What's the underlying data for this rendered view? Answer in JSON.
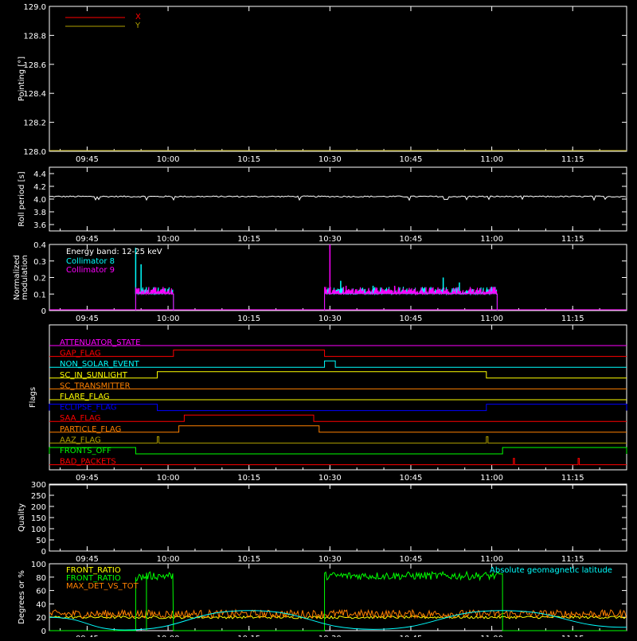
{
  "colors": {
    "background": "#000000",
    "axis": "#ffffff",
    "red": "#ff0000",
    "olive": "#b0a000",
    "cyan": "#00ffff",
    "magenta": "#ff00ff",
    "green": "#00ff00",
    "orange": "#ff8000",
    "yellow": "#ffff00",
    "blue": "#0000ff",
    "quality": "#ffffff"
  },
  "time_ticks": [
    "09:45",
    "10:00",
    "10:15",
    "10:30",
    "10:45",
    "11:00",
    "11:15"
  ],
  "chart_data": [
    {
      "type": "line",
      "id": "pointing",
      "ylabel": "Pointing [°]",
      "ylim": [
        128.0,
        129.0
      ],
      "yticks": [
        "128.0",
        "128.2",
        "128.4",
        "128.6",
        "128.8",
        "129.0"
      ],
      "xlim": [
        "09:38",
        "11:25"
      ],
      "legend": "top-left",
      "series": [
        {
          "name": "X",
          "color": "red",
          "values": []
        },
        {
          "name": "Y",
          "color": "olive",
          "values": []
        }
      ]
    },
    {
      "type": "line",
      "id": "roll",
      "ylabel": "Roll period [s]",
      "ylim": [
        3.5,
        4.5
      ],
      "yticks": [
        "3.6",
        "3.8",
        "4.0",
        "4.2",
        "4.4"
      ],
      "series": [
        {
          "color": "axis",
          "x": [
            "09:38",
            "11:25"
          ],
          "y": [
            4.04,
            4.04
          ]
        }
      ]
    },
    {
      "type": "line",
      "id": "modulation",
      "ylabel": "Normalized modulation",
      "ylim": [
        0,
        0.4
      ],
      "yticks": [
        "0",
        "0.1",
        "0.2",
        "0.3",
        "0.4"
      ],
      "annotation": "Energy band: 12-25 keV",
      "legend": "top-left",
      "series": [
        {
          "name": "Collimator 8",
          "color": "cyan",
          "intervals": [
            [
              "09:54",
              "10:01",
              0.1
            ],
            [
              "10:29",
              "11:01",
              0.1
            ]
          ],
          "spikes": [
            [
              "09:54",
              0.38
            ],
            [
              "09:55",
              0.28
            ],
            [
              "10:32",
              0.18
            ],
            [
              "10:38",
              0.15
            ],
            [
              "10:51",
              0.2
            ],
            [
              "10:54",
              0.17
            ]
          ]
        },
        {
          "name": "Collimator 9",
          "color": "magenta",
          "intervals": [
            [
              "09:54",
              "10:01",
              0.1
            ],
            [
              "10:29",
              "11:01",
              0.1
            ]
          ],
          "spikes": [
            [
              "10:30",
              0.4
            ],
            [
              "10:33",
              0.15
            ],
            [
              "10:42",
              0.15
            ]
          ]
        }
      ]
    },
    {
      "type": "line",
      "id": "flags",
      "ylabel": "Flags",
      "flags": [
        {
          "name": "ATTENUATOR_STATE",
          "color": "magenta",
          "on": []
        },
        {
          "name": "GAP_FLAG",
          "color": "red",
          "on": [
            [
              "10:01",
              "10:29"
            ]
          ]
        },
        {
          "name": "NON_SOLAR_EVENT",
          "color": "cyan",
          "on": [
            [
              "10:29",
              "10:31"
            ]
          ]
        },
        {
          "name": "SC_IN_SUNLIGHT",
          "color": "yellow",
          "on": [
            [
              "09:58",
              "10:59"
            ]
          ]
        },
        {
          "name": "SC_TRANSMITTER",
          "color": "orange",
          "on": []
        },
        {
          "name": "FLARE_FLAG",
          "color": "yellow",
          "on": []
        },
        {
          "name": "ECLIPSE_FLAG",
          "color": "blue",
          "on": [
            [
              "09:38",
              "09:58"
            ],
            [
              "10:59",
              "11:25"
            ]
          ]
        },
        {
          "name": "SAA_FLAG",
          "color": "red",
          "on": [
            [
              "10:03",
              "10:27"
            ]
          ]
        },
        {
          "name": "PARTICLE_FLAG",
          "color": "orange",
          "on": [
            [
              "10:02",
              "10:28"
            ]
          ]
        },
        {
          "name": "AAZ_FLAG",
          "color": "olive",
          "on": [
            [
              "09:58",
              "09:58.3"
            ],
            [
              "10:59",
              "10:59.3"
            ]
          ]
        },
        {
          "name": "FRONTS_OFF",
          "color": "green",
          "on": [
            [
              "09:38",
              "09:54"
            ],
            [
              "11:02",
              "11:25"
            ]
          ]
        },
        {
          "name": "BAD_PACKETS",
          "color": "red",
          "on": [
            [
              "11:04",
              "11:04.2"
            ],
            [
              "11:16",
              "11:16.2"
            ]
          ]
        }
      ]
    },
    {
      "type": "line",
      "id": "quality",
      "ylabel": "Quality",
      "ylim": [
        0,
        300
      ],
      "yticks": [
        "0",
        "50",
        "100",
        "150",
        "200",
        "250",
        "300"
      ],
      "series": [
        {
          "color": "quality",
          "x": [
            "09:38",
            "11:25"
          ],
          "y": [
            300,
            300
          ]
        }
      ]
    },
    {
      "type": "line",
      "id": "ratios",
      "ylabel": "Degrees or %",
      "ylim": [
        0,
        100
      ],
      "yticks": [
        "0",
        "20",
        "40",
        "60",
        "80",
        "100"
      ],
      "legend": "top-left",
      "annotation": "Absolute geomagnetic latitude",
      "series": [
        {
          "name": "FRONT_RATIO",
          "color": "yellow",
          "level": 20
        },
        {
          "name": "FRONT_RATIO",
          "color": "green",
          "segments": [
            [
              "09:38",
              "09:54",
              0
            ],
            [
              "09:54",
              "09:56",
              80
            ],
            [
              "09:56",
              "10:01",
              82
            ],
            [
              "10:01",
              "10:29",
              0
            ],
            [
              "10:29",
              "11:02",
              82
            ],
            [
              "11:02",
              "11:25",
              0
            ]
          ]
        },
        {
          "name": "MAX_DET_VS_TOT",
          "color": "orange",
          "level": 25
        },
        {
          "name": "Absolute geomagnetic latitude",
          "color": "cyan",
          "x": [
            "09:38",
            "09:52",
            "10:15",
            "10:38",
            "11:02",
            "11:25"
          ],
          "y": [
            20,
            1,
            30,
            2,
            30,
            5
          ]
        }
      ]
    }
  ]
}
